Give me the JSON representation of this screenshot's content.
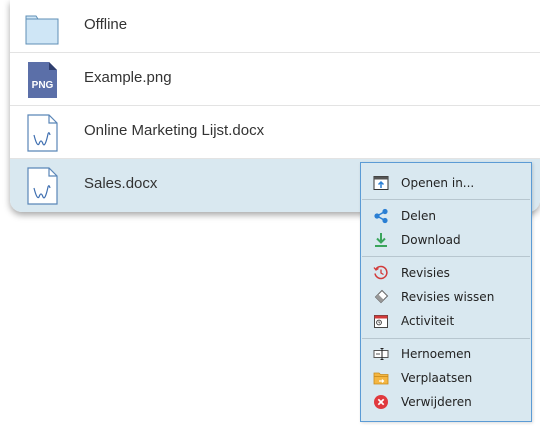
{
  "files": [
    {
      "name": "Offline",
      "icon": "folder-icon"
    },
    {
      "name": "Example.png",
      "icon": "png-file-icon",
      "badge": "PNG"
    },
    {
      "name": "Online Marketing Lijst.docx",
      "icon": "docx-file-icon"
    },
    {
      "name": "Sales.docx",
      "icon": "docx-file-icon",
      "selected": true
    }
  ],
  "context_menu": {
    "open_in": {
      "label": "Openen in...",
      "icon": "open-in-icon"
    },
    "share": {
      "label": "Delen",
      "icon": "share-icon"
    },
    "download": {
      "label": "Download",
      "icon": "download-icon"
    },
    "revisions": {
      "label": "Revisies",
      "icon": "history-icon"
    },
    "clear_revisions": {
      "label": "Revisies wissen",
      "icon": "eraser-icon"
    },
    "activity": {
      "label": "Activiteit",
      "icon": "activity-icon"
    },
    "rename": {
      "label": "Hernoemen",
      "icon": "rename-icon"
    },
    "move": {
      "label": "Verplaatsen",
      "icon": "move-folder-icon"
    },
    "delete": {
      "label": "Verwijderen",
      "icon": "delete-icon"
    }
  },
  "colors": {
    "selected_row": "#d9e8f0",
    "menu_border": "#5b9bd5",
    "png_badge": "#5b6fa8",
    "delete_red": "#e0393e"
  }
}
